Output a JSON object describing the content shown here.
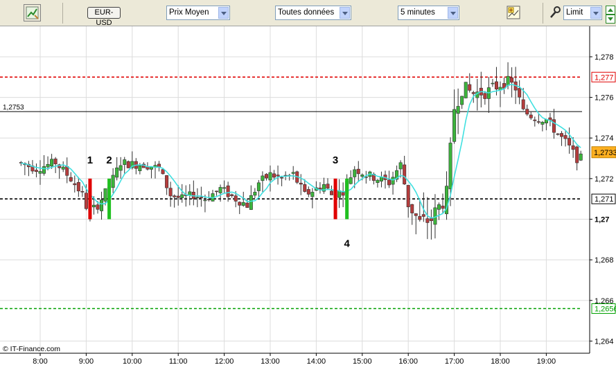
{
  "toolbar": {
    "pair": "EUR-USD",
    "price_mode": "Prix Moyen",
    "data_range": "Toutes données",
    "interval": "5 minutes",
    "order_type": "Limit",
    "icons": [
      "chart-tools-icon",
      "add-indicator-icon",
      "wrench-icon",
      "scroll-up-icon",
      "scroll-down-icon"
    ]
  },
  "watermark": "© IT-Finance.com",
  "chart_data": {
    "type": "candlestick",
    "x_tick_labels": [
      "8:00",
      "9:00",
      "10:00",
      "11:00",
      "12:00",
      "13:00",
      "14:00",
      "15:00",
      "16:00",
      "17:00",
      "18:00",
      "19:00"
    ],
    "y_tick_labels": [
      "1,278",
      "1,276",
      "1,274",
      "1,272",
      "1,27",
      "1,268",
      "1,266",
      "1,264"
    ],
    "ylim": [
      1.2634,
      1.2795
    ],
    "grid": true,
    "colors": {
      "up": "#3cb43c",
      "down": "#b43c3c",
      "ma": "#40e0e0",
      "red_line": "#e00000",
      "green_line": "#00a000",
      "black_line": "#000000"
    },
    "horizontal_lines": [
      {
        "value": 1.277,
        "label": "1,277",
        "style": "dashed",
        "color": "#e00000"
      },
      {
        "value": 1.2753,
        "label": "1,2753",
        "style": "solid",
        "color": "#000000"
      },
      {
        "value": 1.271,
        "label": "1,271",
        "style": "dashed",
        "color": "#000000"
      },
      {
        "value": 1.2656,
        "label": "1,2656",
        "style": "dashed",
        "color": "#00a000"
      }
    ],
    "last_price": {
      "value": 1.2733,
      "label": "1,2733"
    },
    "markers": [
      {
        "label": "1",
        "time": "9:05",
        "color": "#e00000",
        "low": 1.27,
        "high": 1.272,
        "label_pos": "above"
      },
      {
        "label": "2",
        "time": "9:30",
        "color": "#20c020",
        "low": 1.27,
        "high": 1.272,
        "label_pos": "above"
      },
      {
        "label": "3",
        "time": "14:25",
        "color": "#e00000",
        "low": 1.27,
        "high": 1.272,
        "label_pos": "above"
      },
      {
        "label": "4",
        "time": "14:40",
        "color": "#20c020",
        "low": 1.27,
        "high": 1.272,
        "label_pos": "below"
      }
    ],
    "price_path": [
      [
        "7:35",
        1.2728
      ],
      [
        "8:00",
        1.2725
      ],
      [
        "8:25",
        1.2728
      ],
      [
        "8:45",
        1.272
      ],
      [
        "9:00",
        1.2712
      ],
      [
        "9:08",
        1.2703
      ],
      [
        "9:20",
        1.2707
      ],
      [
        "9:35",
        1.2716
      ],
      [
        "9:50",
        1.2728
      ],
      [
        "10:05",
        1.2727
      ],
      [
        "10:20",
        1.2727
      ],
      [
        "10:40",
        1.2725
      ],
      [
        "10:55",
        1.2712
      ],
      [
        "11:10",
        1.271
      ],
      [
        "11:25",
        1.2712
      ],
      [
        "11:40",
        1.271
      ],
      [
        "12:00",
        1.2715
      ],
      [
        "12:20",
        1.271
      ],
      [
        "12:35",
        1.2707
      ],
      [
        "12:50",
        1.2718
      ],
      [
        "13:05",
        1.2722
      ],
      [
        "13:20",
        1.272
      ],
      [
        "13:35",
        1.2722
      ],
      [
        "13:50",
        1.2712
      ],
      [
        "14:05",
        1.2715
      ],
      [
        "14:15",
        1.2717
      ],
      [
        "14:25",
        1.2712
      ],
      [
        "14:40",
        1.2714
      ],
      [
        "14:55",
        1.2725
      ],
      [
        "15:10",
        1.2722
      ],
      [
        "15:25",
        1.272
      ],
      [
        "15:40",
        1.2718
      ],
      [
        "15:55",
        1.2727
      ],
      [
        "16:05",
        1.2708
      ],
      [
        "16:20",
        1.2698
      ],
      [
        "16:35",
        1.27
      ],
      [
        "16:55",
        1.2712
      ],
      [
        "17:05",
        1.2755
      ],
      [
        "17:15",
        1.2765
      ],
      [
        "17:30",
        1.2762
      ],
      [
        "17:50",
        1.2763
      ],
      [
        "18:10",
        1.2768
      ],
      [
        "18:25",
        1.2765
      ],
      [
        "18:35",
        1.2753
      ],
      [
        "18:50",
        1.275
      ],
      [
        "19:05",
        1.2749
      ],
      [
        "19:20",
        1.2742
      ],
      [
        "19:30",
        1.2738
      ],
      [
        "19:45",
        1.273
      ]
    ]
  }
}
